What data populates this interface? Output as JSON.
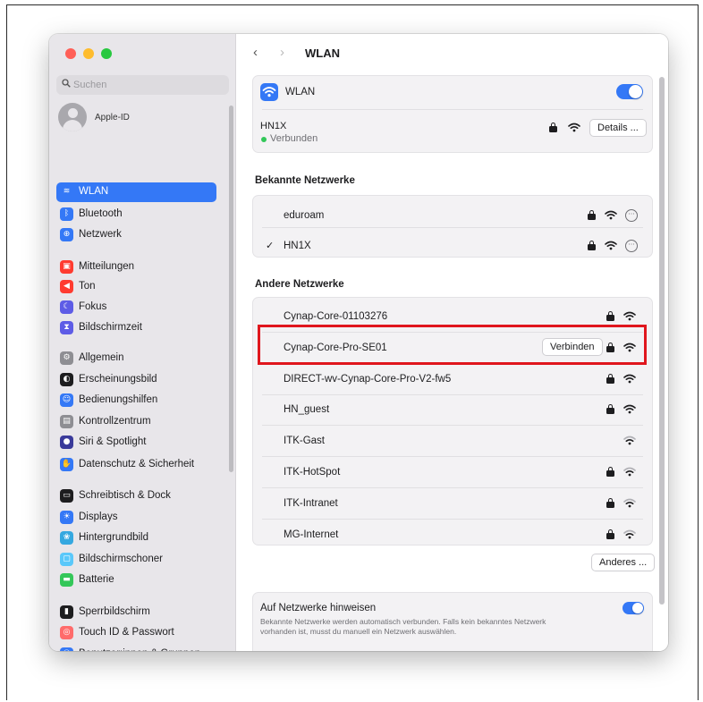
{
  "colors": {
    "accent": "#3478f6",
    "highlight": "#e0161d",
    "connected": "#32c759"
  },
  "sidebar": {
    "search_placeholder": "Suchen",
    "apple_id": "Apple-ID",
    "items": [
      {
        "label": "WLAN",
        "icon": "wifi-icon",
        "color": "#3478f6"
      },
      {
        "label": "Bluetooth",
        "icon": "bluetooth-icon",
        "color": "#3478f6"
      },
      {
        "label": "Netzwerk",
        "icon": "globe-icon",
        "color": "#3478f6"
      },
      {
        "label": "Mitteilungen",
        "icon": "notifications-icon",
        "color": "#ff3b30"
      },
      {
        "label": "Ton",
        "icon": "speaker-icon",
        "color": "#ff3b30"
      },
      {
        "label": "Fokus",
        "icon": "moon-icon",
        "color": "#5e5ce6"
      },
      {
        "label": "Bildschirmzeit",
        "icon": "hourglass-icon",
        "color": "#5e5ce6"
      },
      {
        "label": "Allgemein",
        "icon": "gear-icon",
        "color": "#8e8e93"
      },
      {
        "label": "Erscheinungsbild",
        "icon": "appearance-icon",
        "color": "#1d1d1f"
      },
      {
        "label": "Bedienungshilfen",
        "icon": "accessibility-icon",
        "color": "#3478f6"
      },
      {
        "label": "Kontrollzentrum",
        "icon": "control-center-icon",
        "color": "#8e8e93"
      },
      {
        "label": "Siri & Spotlight",
        "icon": "siri-icon",
        "color": "#3a3a9a"
      },
      {
        "label": "Datenschutz & Sicherheit",
        "icon": "hand-icon",
        "color": "#3478f6"
      },
      {
        "label": "Schreibtisch & Dock",
        "icon": "dock-icon",
        "color": "#1d1d1f"
      },
      {
        "label": "Displays",
        "icon": "sun-icon",
        "color": "#3478f6"
      },
      {
        "label": "Hintergrundbild",
        "icon": "wallpaper-icon",
        "color": "#35a8e0"
      },
      {
        "label": "Bildschirmschoner",
        "icon": "screensaver-icon",
        "color": "#5ac8fa"
      },
      {
        "label": "Batterie",
        "icon": "battery-icon",
        "color": "#34c759"
      },
      {
        "label": "Sperrbildschirm",
        "icon": "lock-screen-icon",
        "color": "#1d1d1f"
      },
      {
        "label": "Touch ID & Passwort",
        "icon": "fingerprint-icon",
        "color": "#ff6b6b"
      },
      {
        "label": "Benutzer:innen & Gruppen",
        "icon": "users-icon",
        "color": "#3478f6"
      }
    ]
  },
  "toolbar": {
    "back": "‹",
    "forward": "›",
    "title": "WLAN"
  },
  "wlan_card": {
    "label": "WLAN",
    "current_network": "HN1X",
    "status": "Verbunden",
    "details_button": "Details ..."
  },
  "known": {
    "heading": "Bekannte Netzwerke",
    "networks": [
      {
        "name": "eduroam",
        "checked": ""
      },
      {
        "name": "HN1X",
        "checked": "✓"
      }
    ]
  },
  "other": {
    "heading": "Andere Netzwerke",
    "networks": [
      {
        "name": "Cynap-Core-01103276",
        "locked": true
      },
      {
        "name": "Cynap-Core-Pro-SE01",
        "locked": true,
        "connect_label": "Verbinden"
      },
      {
        "name": "DIRECT-wv-Cynap-Core-Pro-V2-fw5",
        "locked": true
      },
      {
        "name": "HN_guest",
        "locked": true
      },
      {
        "name": "ITK-Gast",
        "locked": false
      },
      {
        "name": "ITK-HotSpot",
        "locked": true
      },
      {
        "name": "ITK-Intranet",
        "locked": true
      },
      {
        "name": "MG-Internet",
        "locked": true
      }
    ],
    "other_button": "Anderes ..."
  },
  "notify": {
    "title": "Auf Netzwerke hinweisen",
    "description_line1": "Bekannte Netzwerke werden automatisch verbunden. Falls kein bekanntes Netzwerk",
    "description_line2": "vorhanden ist, musst du manuell ein Netzwerk auswählen."
  }
}
